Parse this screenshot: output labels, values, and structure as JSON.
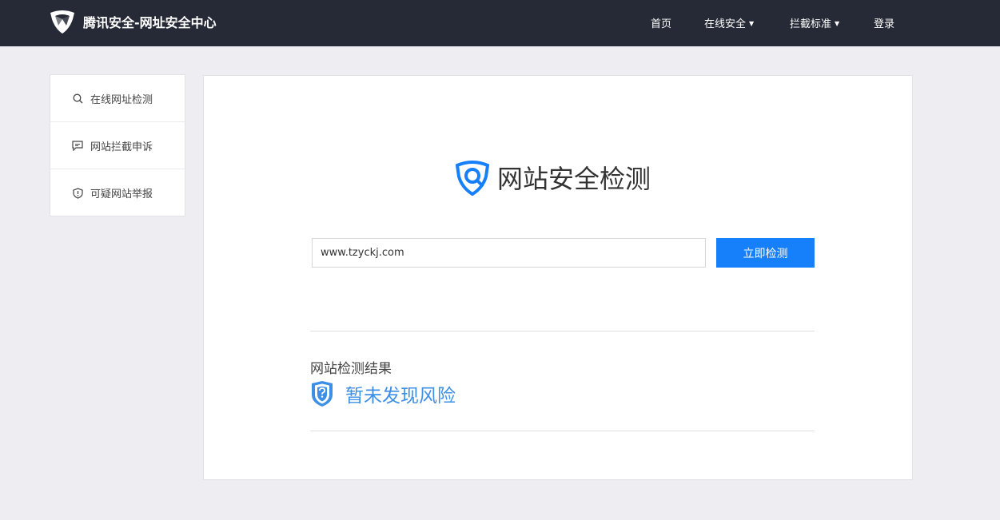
{
  "header": {
    "brand": "腾讯安全-网址安全中心",
    "nav": [
      {
        "label": "首页",
        "has_dropdown": false
      },
      {
        "label": "在线安全",
        "has_dropdown": true
      },
      {
        "label": "拦截标准",
        "has_dropdown": true
      },
      {
        "label": "登录",
        "has_dropdown": false
      }
    ],
    "caret_glyph": "▼"
  },
  "sidebar": {
    "items": [
      {
        "label": "在线网址检测",
        "icon": "search-icon"
      },
      {
        "label": "网站拦截申诉",
        "icon": "chat-icon"
      },
      {
        "label": "可疑网站举报",
        "icon": "shield-alert-icon"
      }
    ]
  },
  "main": {
    "title": "网站安全检测",
    "url_input": {
      "value": "www.tzyckj.com"
    },
    "check_button": "立即检测",
    "result": {
      "title": "网站检测结果",
      "status": "暂未发现风险"
    }
  },
  "colors": {
    "header_bg": "#262a36",
    "accent": "#167ffa",
    "result_text": "#3d8fe6",
    "page_bg": "#eeeef2"
  }
}
